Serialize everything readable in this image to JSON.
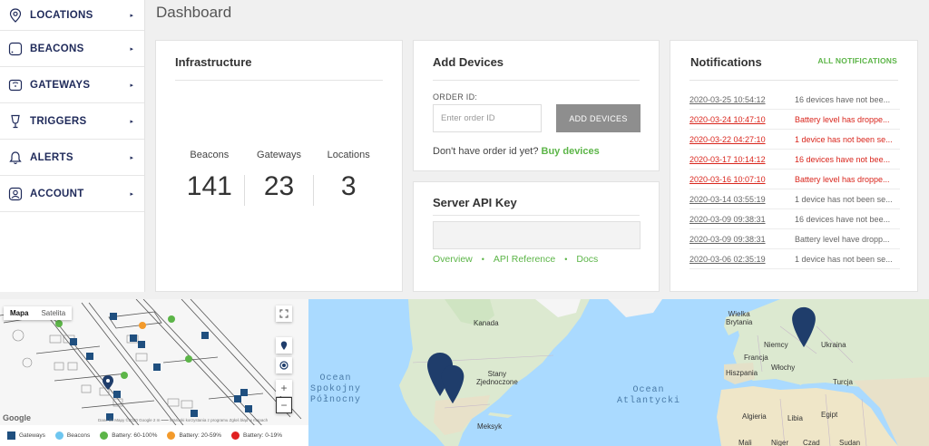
{
  "sidebar": {
    "items": [
      {
        "label": "LOCATIONS",
        "icon": "location-pin-icon"
      },
      {
        "label": "BEACONS",
        "icon": "beacon-icon"
      },
      {
        "label": "GATEWAYS",
        "icon": "gateway-icon"
      },
      {
        "label": "TRIGGERS",
        "icon": "trigger-icon"
      },
      {
        "label": "ALERTS",
        "icon": "bell-icon"
      },
      {
        "label": "ACCOUNT",
        "icon": "user-icon"
      }
    ],
    "caret": "▸"
  },
  "page_title": "Dashboard",
  "infrastructure": {
    "title": "Infrastructure",
    "stats": [
      {
        "label": "Beacons",
        "value": "141"
      },
      {
        "label": "Gateways",
        "value": "23"
      },
      {
        "label": "Locations",
        "value": "3"
      }
    ]
  },
  "add_devices": {
    "title": "Add Devices",
    "order_label": "ORDER ID:",
    "order_placeholder": "Enter order ID",
    "button_label": "ADD DEVICES",
    "hint": "Don't have order id yet?",
    "hint_link": "Buy devices"
  },
  "server_api": {
    "title": "Server API Key",
    "links": [
      "Overview",
      "API Reference",
      "Docs"
    ]
  },
  "notifications": {
    "title": "Notifications",
    "all_link": "ALL NOTIFICATIONS",
    "items": [
      {
        "time": "2020-03-25 10:54:12",
        "message": "16 devices have not bee...",
        "alert": false
      },
      {
        "time": "2020-03-24 10:47:10",
        "message": "Battery level has droppe...",
        "alert": true
      },
      {
        "time": "2020-03-22 04:27:10",
        "message": "1 device has not been se...",
        "alert": true
      },
      {
        "time": "2020-03-17 10:14:12",
        "message": "16 devices have not bee...",
        "alert": true
      },
      {
        "time": "2020-03-16 10:07:10",
        "message": "Battery level has droppe...",
        "alert": true
      },
      {
        "time": "2020-03-14 03:55:19",
        "message": "1 device has not been se...",
        "alert": false
      },
      {
        "time": "2020-03-09 09:38:31",
        "message": "16 devices have not bee...",
        "alert": false
      },
      {
        "time": "2020-03-09 09:38:31",
        "message": "Battery level have dropp...",
        "alert": false
      },
      {
        "time": "2020-03-06 02:35:19",
        "message": "1 device has not been se...",
        "alert": false
      }
    ]
  },
  "floor_map": {
    "tabs": [
      "Mapa",
      "Satelita"
    ],
    "google": "Google",
    "credit": "Dane do Mapy ©2020 Google   2 m ━━━   Warunki korzystania z programu   Zgłoś błąd w mapach"
  },
  "legend": [
    {
      "label": "Gateways",
      "color": "#1f4f7f",
      "shape": "square"
    },
    {
      "label": "Beacons",
      "color": "#6ec6f0",
      "shape": "circle"
    },
    {
      "label": "Battery: 60-100%",
      "color": "#5cb548",
      "shape": "circle"
    },
    {
      "label": "Battery: 20-59%",
      "color": "#f39a2b",
      "shape": "circle"
    },
    {
      "label": "Battery: 0-19%",
      "color": "#e02020",
      "shape": "circle"
    }
  ],
  "world_map": {
    "labels": {
      "kanada": "Kanada",
      "stany": "Stany\nZjednoczone",
      "meksyk": "Meksyk",
      "wielka": "Wielka\nBrytania",
      "niemcy": "Niemcy",
      "ukraina": "Ukraina",
      "francja": "Francja",
      "wlochy": "Włochy",
      "hiszpania": "Hiszpania",
      "turcja": "Turcja",
      "algieria": "Algieria",
      "libia": "Libia",
      "egipt": "Egipt",
      "mali": "Mali",
      "sudan": "Sudan",
      "niger": "Niger",
      "czad": "Czad",
      "ocean_spokojny": "Ocean\nSpokojny\nPółnocny",
      "ocean_atlantycki": "Ocean\nAtlantycki"
    }
  },
  "colors": {
    "accent": "#5cb548",
    "alert": "#d9251c",
    "navy": "#1f2a5a",
    "pin": "#1f3d6b"
  }
}
